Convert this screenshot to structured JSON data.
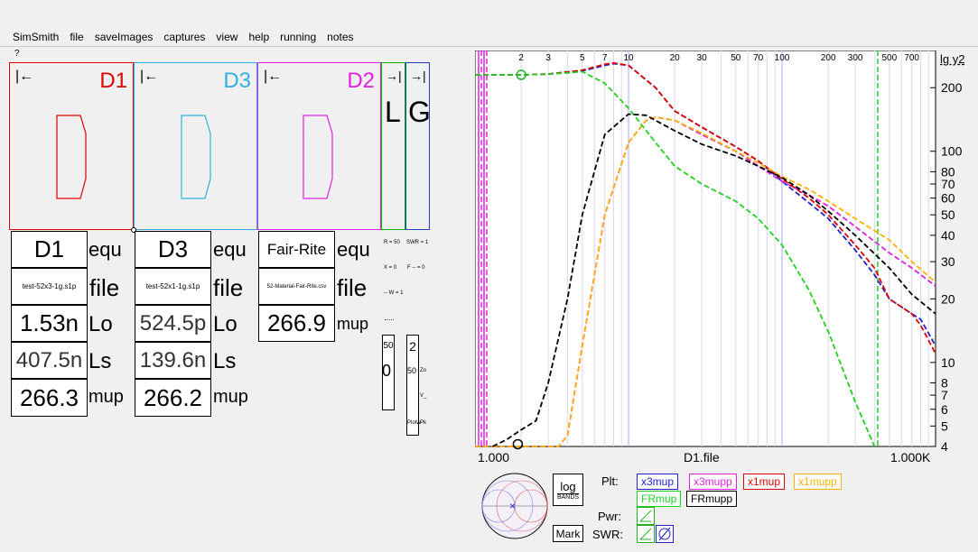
{
  "menu": [
    "SimSmith",
    "file",
    "saveImages",
    "captures",
    "view",
    "help",
    "running",
    "notes"
  ],
  "help_mark": "?",
  "panels": [
    {
      "name": "D1",
      "color": "#e00000",
      "arrow": "|←"
    },
    {
      "name": "D3",
      "color": "#30b0e0",
      "arrow": "|←"
    },
    {
      "name": "D2",
      "color": "#e020e0",
      "arrow": "|←"
    }
  ],
  "side_panels": [
    {
      "letter": "L",
      "color": "#00b000",
      "arrow": "→|"
    },
    {
      "letter": "G",
      "color": "#2040c0",
      "arrow": "→|"
    }
  ],
  "col1": {
    "title": "D1",
    "title_suffix": "equ",
    "file": "test-52x3-1g.s1p",
    "file_suffix": "file",
    "lo": "1.53n",
    "lo_suffix": "Lo",
    "ls": "407.5n",
    "ls_suffix": "Ls",
    "mup": "266.3",
    "mup_suffix": "mup"
  },
  "col2": {
    "title": "D3",
    "title_suffix": "equ",
    "file": "test-52x1-1g.s1p",
    "file_suffix": "file",
    "lo": "524.5p",
    "lo_suffix": "Lo",
    "ls": "139.6n",
    "ls_suffix": "Ls",
    "mup": "266.2",
    "mup_suffix": "mup"
  },
  "col3": {
    "title": "Fair-Rite",
    "title_suffix": "equ",
    "file": "52-Material-Fair-Rite.csv",
    "file_suffix": "file",
    "mup": "266.9",
    "mup_suffix": "mup"
  },
  "mini": {
    "r": "R = 50",
    "swr": "SWR = 1",
    "x": "X = 0",
    "f": "F -- = 0",
    "w": "-- W = 1",
    "s1": "50",
    "s2": "2",
    "s3": "0",
    "s4": "50",
    "s5": "Zo",
    "s6": "V_",
    "s7": "Plotw",
    "s8": "Pk"
  },
  "chart_data": {
    "type": "line",
    "xlabel": "D1.file",
    "x_axis_labels": [
      "1.000",
      "1.000K"
    ],
    "x_ticks": [
      "2",
      "3",
      "5",
      "7",
      "10",
      "20",
      "30",
      "50",
      "70",
      "100",
      "200",
      "300",
      "500",
      "700"
    ],
    "y_title": "lg y2",
    "y_ticks": [
      "200",
      "100",
      "80",
      "70",
      "60",
      "50",
      "40",
      "30",
      "20",
      "10",
      "8",
      "7",
      "6",
      "5",
      "4"
    ],
    "xlim": [
      1,
      1000
    ],
    "ylim": [
      4,
      300
    ],
    "log_x": true,
    "log_y": true,
    "series": [
      {
        "name": "x3mup",
        "color": "#2020d0",
        "x": [
          1,
          1.5,
          2,
          3,
          5,
          7,
          8,
          10,
          15,
          20,
          30,
          50,
          70,
          100,
          150,
          200,
          300,
          400,
          500,
          700,
          800,
          1000
        ],
        "y": [
          230,
          230,
          230,
          232,
          240,
          255,
          260,
          255,
          200,
          155,
          130,
          105,
          90,
          72,
          57,
          48,
          34,
          26,
          20,
          17,
          16,
          12
        ]
      },
      {
        "name": "x3mupp",
        "color": "#e020e0",
        "x": [
          1,
          3,
          3.5,
          4,
          5,
          7,
          10,
          13,
          15,
          20,
          30,
          50,
          70,
          100,
          150,
          200,
          300,
          500,
          700,
          1000
        ],
        "y": [
          4,
          4,
          4,
          4.5,
          12,
          50,
          110,
          140,
          145,
          140,
          120,
          100,
          85,
          72,
          62,
          55,
          44,
          33,
          28,
          23
        ]
      },
      {
        "name": "x1mup",
        "color": "#e00000",
        "x": [
          1,
          1.5,
          2,
          3,
          5,
          7,
          8,
          10,
          15,
          20,
          30,
          50,
          70,
          100,
          150,
          200,
          300,
          400,
          500,
          700,
          800,
          1000
        ],
        "y": [
          230,
          230,
          230,
          232,
          242,
          258,
          262,
          255,
          200,
          155,
          130,
          105,
          90,
          74,
          60,
          50,
          36,
          28,
          20,
          17,
          15,
          11
        ]
      },
      {
        "name": "x1mupp",
        "color": "#ffb000",
        "x": [
          1,
          3,
          3.5,
          4,
          5,
          7,
          10,
          13,
          15,
          20,
          30,
          50,
          70,
          100,
          150,
          200,
          300,
          500,
          700,
          1000
        ],
        "y": [
          4,
          4,
          4,
          4.5,
          12,
          50,
          110,
          140,
          145,
          140,
          122,
          100,
          88,
          76,
          66,
          58,
          48,
          38,
          30,
          24
        ]
      },
      {
        "name": "FRmup",
        "color": "#20d020",
        "x": [
          1,
          1.5,
          2,
          3,
          4,
          5,
          7,
          10,
          15,
          20,
          30,
          50,
          70,
          100,
          150,
          200,
          300,
          400
        ],
        "y": [
          230,
          230,
          230,
          232,
          235,
          238,
          210,
          160,
          110,
          85,
          70,
          58,
          48,
          36,
          22,
          14,
          6.5,
          4
        ]
      },
      {
        "name": "FRmupp",
        "color": "#000000",
        "x": [
          1.3,
          1.6,
          2,
          2.5,
          3,
          4,
          5,
          7,
          10,
          13,
          15,
          20,
          30,
          50,
          70,
          100,
          150,
          200,
          300,
          500,
          700,
          1000
        ],
        "y": [
          4,
          4.3,
          4.8,
          5.3,
          8,
          20,
          50,
          120,
          150,
          148,
          140,
          125,
          108,
          95,
          85,
          75,
          62,
          52,
          40,
          28,
          21,
          17
        ]
      }
    ]
  },
  "controls": {
    "log": "log",
    "bands": "BANDS",
    "mark": "Mark",
    "plt": "Plt:",
    "pwr": "Pwr:",
    "swr": "SWR:"
  },
  "legend": [
    "x3mup",
    "x3mupp",
    "x1mup",
    "x1mupp",
    "FRmup",
    "FRmupp"
  ]
}
